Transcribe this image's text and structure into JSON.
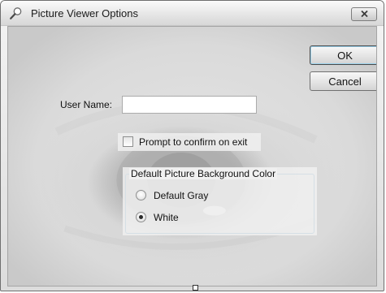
{
  "window": {
    "title": "Picture Viewer Options",
    "close_label": "✕"
  },
  "buttons": {
    "ok_label": "OK",
    "cancel_label": "Cancel"
  },
  "form": {
    "username_label": "User Name:",
    "username_value": "",
    "prompt_checkbox_label": "Prompt to confirm on exit",
    "prompt_checked": false
  },
  "groupbox": {
    "title": "Default Picture Background Color",
    "options": [
      {
        "label": "Default Gray",
        "selected": false
      },
      {
        "label": "White",
        "selected": true
      }
    ]
  },
  "icons": {
    "title_icon": "magnifier-icon",
    "close_icon": "close-icon"
  },
  "colors": {
    "title_gradient_top": "#fbfbfb",
    "title_gradient_bottom": "#d7d7d7"
  }
}
